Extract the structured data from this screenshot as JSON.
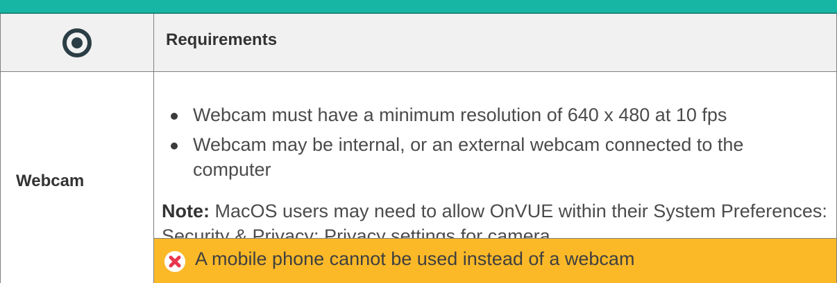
{
  "header": {
    "icon": "target-icon",
    "title": "Requirements"
  },
  "row": {
    "label": "Webcam",
    "bullets": [
      "Webcam must have a minimum resolution of 640 x 480 at 10 fps",
      "Webcam may be internal, or an external webcam connected to the computer"
    ],
    "note_label": "Note:",
    "note_text": " MacOS users may need to allow OnVUE within their System Preferences: Security & Privacy: Privacy settings for camera",
    "warning": {
      "icon": "error-x-icon",
      "text": "A mobile phone cannot be used instead of a webcam"
    }
  },
  "colors": {
    "top_bar": "#17b6a4",
    "header_bg": "#f1f1f1",
    "warning_bg": "#fbb928",
    "error_icon": "#e8364e",
    "target_icon": "#2c3e45"
  }
}
